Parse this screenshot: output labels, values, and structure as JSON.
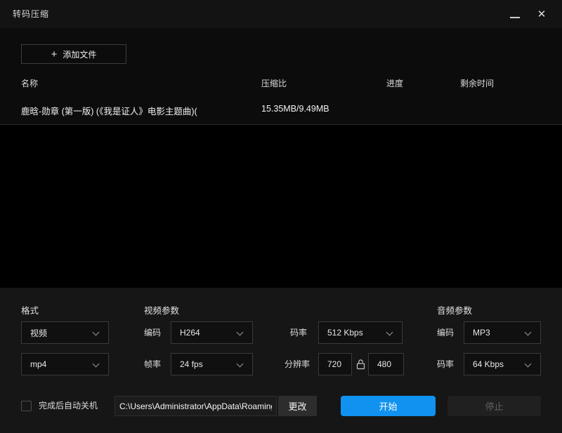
{
  "window": {
    "title": "转码压缩"
  },
  "icons": {
    "plus": "+",
    "close": "✕"
  },
  "toolbar": {
    "add_file_label": "添加文件"
  },
  "table": {
    "headers": [
      "名称",
      "压缩比",
      "进度",
      "剩余时间"
    ],
    "rows": [
      {
        "name": "鹿晗-勋章 (第一版) (《我是证人》电影主题曲)(",
        "ratio": "15.35MB/9.49MB",
        "progress": "",
        "remaining": ""
      }
    ]
  },
  "settings": {
    "sections": {
      "format": "格式",
      "video": "视频参数",
      "audio": "音频参数"
    },
    "format": {
      "type_value": "视频",
      "container_value": "mp4"
    },
    "video": {
      "codec_label": "编码",
      "codec_value": "H264",
      "framerate_label": "帧率",
      "framerate_value": "24 fps",
      "bitrate_label": "码率",
      "bitrate_value": "512 Kbps",
      "resolution_label": "分辨率",
      "resolution_width": "720",
      "resolution_height": "480"
    },
    "audio": {
      "codec_label": "编码",
      "codec_value": "MP3",
      "bitrate_label": "码率",
      "bitrate_value": "64 Kbps"
    }
  },
  "footer": {
    "shutdown_label": "完成后自动关机",
    "shutdown_checked": false,
    "output_path": "C:\\Users\\Administrator\\AppData\\Roaming",
    "change_label": "更改",
    "start_label": "开始",
    "stop_label": "停止"
  },
  "colors": {
    "accent_blue": "#1192f0",
    "titlebar_bg": "#131313",
    "panel_bg": "#161616",
    "list_bg": "#000000"
  }
}
